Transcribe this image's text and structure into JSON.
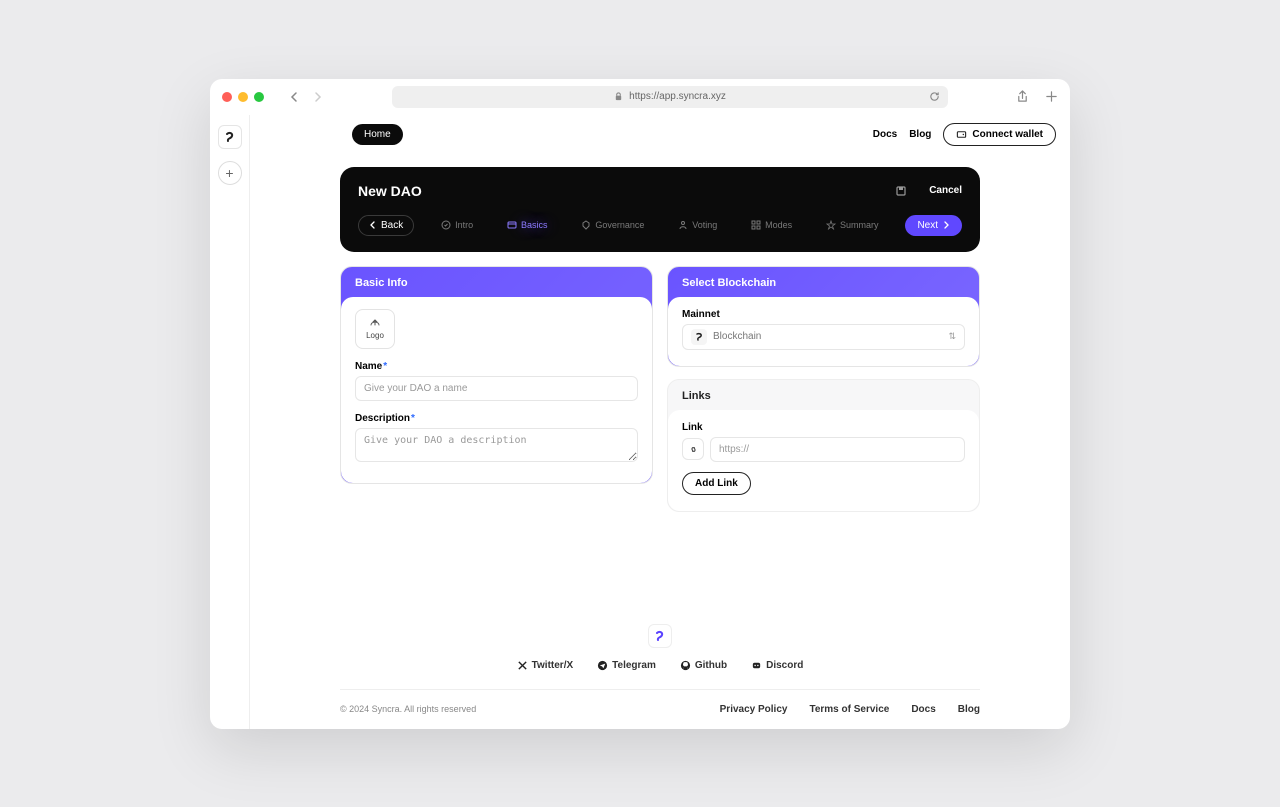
{
  "browser": {
    "url": "https://app.syncra.xyz"
  },
  "header": {
    "home": "Home",
    "docs": "Docs",
    "blog": "Blog",
    "connect": "Connect wallet"
  },
  "wizard": {
    "title": "New DAO",
    "cancel": "Cancel",
    "back": "Back",
    "next": "Next",
    "steps": {
      "intro": "Intro",
      "basics": "Basics",
      "governance": "Governance",
      "voting": "Voting",
      "modes": "Modes",
      "summary": "Summary"
    }
  },
  "basicInfo": {
    "title": "Basic Info",
    "logoLabel": "Logo",
    "nameLabel": "Name",
    "namePlaceholder": "Give your DAO a name",
    "descLabel": "Description",
    "descPlaceholder": "Give your DAO a description"
  },
  "blockchain": {
    "title": "Select Blockchain",
    "mainnetLabel": "Mainnet",
    "selectPlaceholder": "Blockchain"
  },
  "links": {
    "title": "Links",
    "linkLabel": "Link",
    "linkPlaceholder": "https://",
    "addLink": "Add Link"
  },
  "footer": {
    "socials": {
      "twitter": "Twitter/X",
      "telegram": "Telegram",
      "github": "Github",
      "discord": "Discord"
    },
    "copyright": "© 2024 Syncra. All rights reserved",
    "privacy": "Privacy Policy",
    "terms": "Terms of Service",
    "docs": "Docs",
    "blog": "Blog"
  }
}
